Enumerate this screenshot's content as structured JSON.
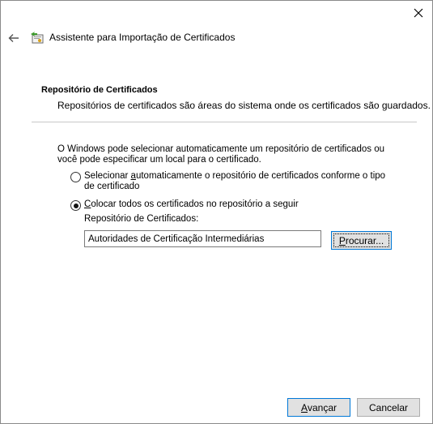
{
  "window": {
    "title": "Assistente para Importação de Certificados"
  },
  "section": {
    "title": "Repositório de Certificados",
    "description": "Repositórios de certificados são áreas do sistema onde os certificados são guardados."
  },
  "intro_text": "O Windows pode selecionar automaticamente um repositório de certificados ou você pode especificar um local para o certificado.",
  "options": [
    {
      "label_pre": "Selecionar ",
      "label_underline": "a",
      "label_post": "utomaticamente o repositório de certificados conforme o tipo de certificado",
      "selected": false
    },
    {
      "label_pre": "",
      "label_underline": "C",
      "label_post": "olocar todos os certificados no repositório a seguir",
      "selected": true
    }
  ],
  "store": {
    "label": "Repositório de Certificados:",
    "value": "Autoridades de Certificação Intermediárias",
    "browse_underline": "P",
    "browse_rest": "rocurar..."
  },
  "footer": {
    "next_underline": "A",
    "next_rest": "vançar",
    "cancel_label": "Cancelar"
  },
  "icons": {
    "close": "close-icon",
    "back": "back-arrow-icon",
    "wizard": "certificate-wizard-icon"
  }
}
